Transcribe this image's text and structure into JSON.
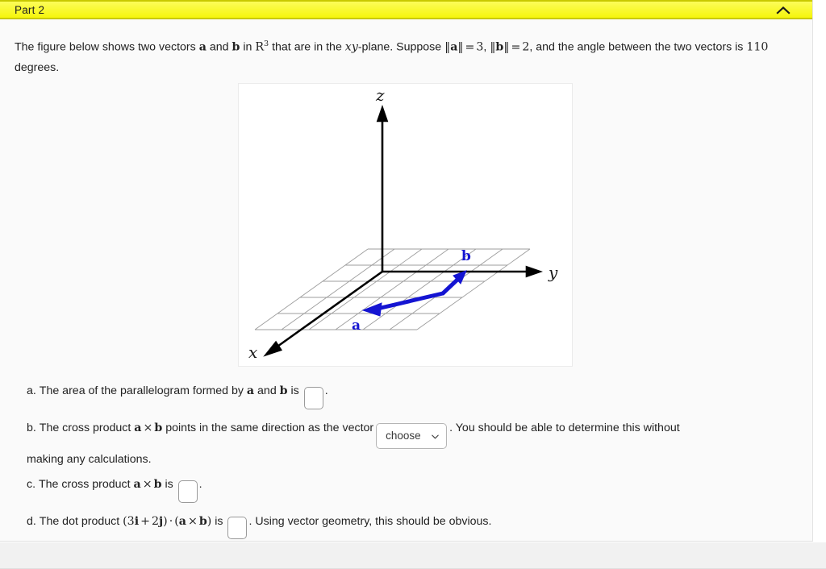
{
  "header": {
    "title": "Part 2",
    "collapse_icon": "chevron-up-icon",
    "background_color": "#f5f50b"
  },
  "intro": {
    "text_plain": "The figure below shows two vectors a and b in R^3 that are in the xy-plane. Suppose ||a|| = 3, ||b|| = 2, and the angle between the two vectors is 110 degrees.",
    "seg_1": "The figure below shows two vectors ",
    "vec_a": "a",
    "seg_2": " and ",
    "vec_b": "b",
    "seg_3": " in ",
    "field_R": "R",
    "field_exp": "3",
    "seg_4": " that are in the ",
    "plane_x": "x",
    "plane_y": "y",
    "seg_5": "-plane. Suppose ",
    "norm_a_open": "‖",
    "norm_a_vec": "a",
    "norm_a_close": "‖",
    "eq_1": "=",
    "mag_a": "3",
    "comma_1": ",",
    "norm_b_open": "‖",
    "norm_b_vec": "b",
    "norm_b_close": "‖",
    "eq_2": "=",
    "mag_b": "2",
    "seg_6": ", and the angle between the two vectors is ",
    "angle": "110",
    "seg_7": " degrees."
  },
  "figure": {
    "name": "3d-vector-diagram",
    "caption": "Two vectors a and b drawn in the xy-plane of a 3D coordinate system",
    "axis_labels": {
      "x": "x",
      "y": "y",
      "z": "z"
    },
    "vector_labels": {
      "a": "a",
      "b": "b"
    },
    "vector_color": "#1414d2",
    "axis_color": "#000000",
    "grid_color": "#9a9a9a",
    "grid_rows": 5,
    "grid_cols": 6
  },
  "questions": [
    {
      "id": "a",
      "label": "a.",
      "seg_1": "The area of the parallelogram formed by ",
      "vec_a": "a",
      "seg_2": " and ",
      "vec_b": "b",
      "seg_3": " is",
      "answer_value": "",
      "answer_placeholder": "",
      "seg_4": "."
    },
    {
      "id": "b",
      "label": "b.",
      "seg_1": "The cross product ",
      "vec_a": "a",
      "cross": "×",
      "vec_b": "b",
      "seg_2": " points in the same direction as the vector",
      "select_value": "choose",
      "select_icon": "chevron-down-icon",
      "seg_3": ". You should be able to determine this without",
      "seg_4": "making any calculations."
    },
    {
      "id": "c",
      "label": "c.",
      "seg_1": "The cross product ",
      "vec_a": "a",
      "cross": "×",
      "vec_b": "b",
      "seg_2": " is",
      "answer_value": "",
      "answer_placeholder": "",
      "seg_3": "."
    },
    {
      "id": "d",
      "label": "d.",
      "seg_1": "The dot product ",
      "expr_open": "(",
      "coef_i": "3",
      "unit_i": "i",
      "plus": "+",
      "coef_j": "2",
      "unit_j": "j",
      "expr_close": ")",
      "dot": "·",
      "expr2_open": "(",
      "vec_a": "a",
      "cross": "×",
      "vec_b": "b",
      "expr2_close": ")",
      "seg_2": " is",
      "answer_value": "",
      "answer_placeholder": "",
      "seg_3": ". Using vector geometry, this should be obvious."
    }
  ]
}
